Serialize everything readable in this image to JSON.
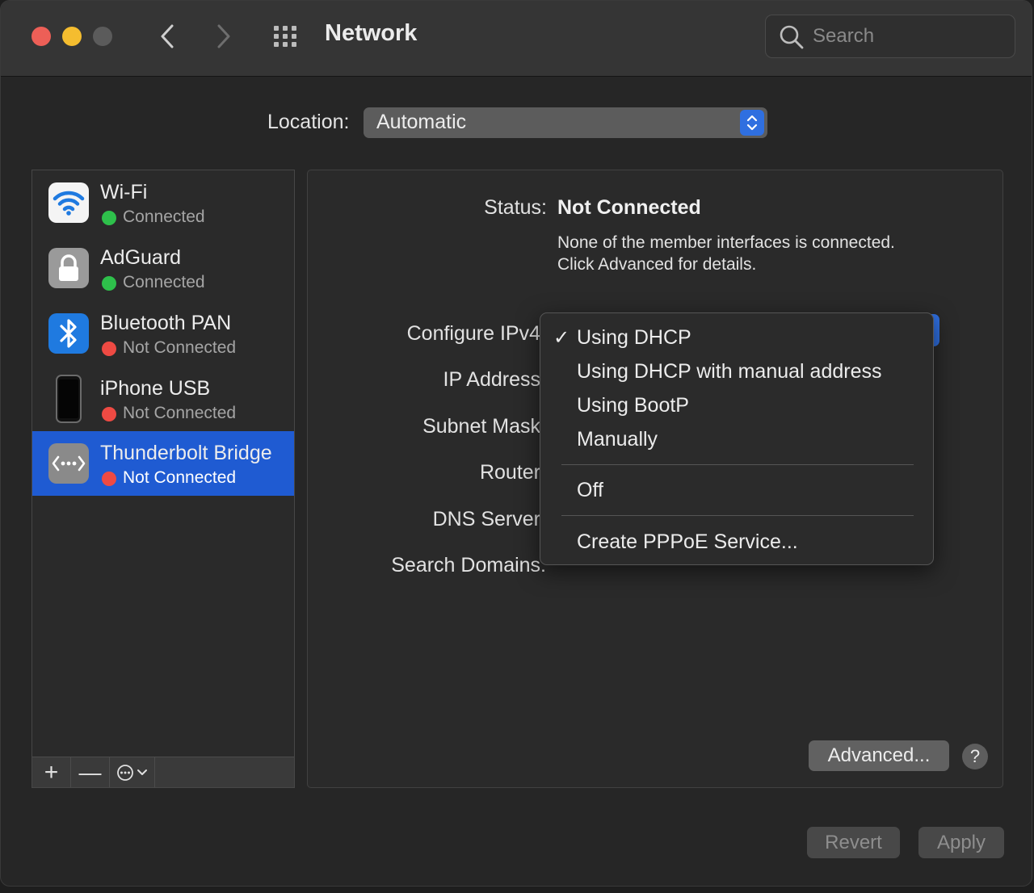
{
  "window": {
    "title": "Network"
  },
  "search": {
    "placeholder": "Search"
  },
  "location": {
    "label": "Location:",
    "value": "Automatic"
  },
  "services": [
    {
      "name": "Wi-Fi",
      "status": "Connected",
      "status_color": "#2ec04b",
      "icon": "wifi-icon"
    },
    {
      "name": "AdGuard",
      "status": "Connected",
      "status_color": "#2ec04b",
      "icon": "lock-icon"
    },
    {
      "name": "Bluetooth PAN",
      "status": "Not Connected",
      "status_color": "#ee4a43",
      "icon": "bluetooth-icon"
    },
    {
      "name": "iPhone USB",
      "status": "Not Connected",
      "status_color": "#ee4a43",
      "icon": "iphone-icon"
    },
    {
      "name": "Thunderbolt Bridge",
      "status": "Not Connected",
      "status_color": "#ee4a43",
      "icon": "thunderbolt-bridge-icon",
      "selected": true
    }
  ],
  "sidebar_toolbar": {
    "add": "+",
    "remove": "—"
  },
  "panel": {
    "status_label": "Status:",
    "status_value": "Not Connected",
    "status_desc_line1": "None of the member interfaces is connected.",
    "status_desc_line2": "Click Advanced for details.",
    "fields": {
      "configure_ipv4": "Configure IPv4",
      "ip_address": "IP Address",
      "subnet_mask": "Subnet Mask",
      "router": "Router",
      "dns_server": "DNS Server",
      "search_domains": "Search Domains:"
    },
    "advanced_label": "Advanced...",
    "help_label": "?"
  },
  "ipv4_menu": {
    "items": [
      "Using DHCP",
      "Using DHCP with manual address",
      "Using BootP",
      "Manually",
      "Off",
      "Create PPPoE Service..."
    ],
    "checked": "Using DHCP",
    "check_glyph": "✓"
  },
  "footer": {
    "revert_label": "Revert",
    "apply_label": "Apply"
  },
  "colors": {
    "accent": "#1f5bd2",
    "popup_blue": "#2f6fe0"
  }
}
